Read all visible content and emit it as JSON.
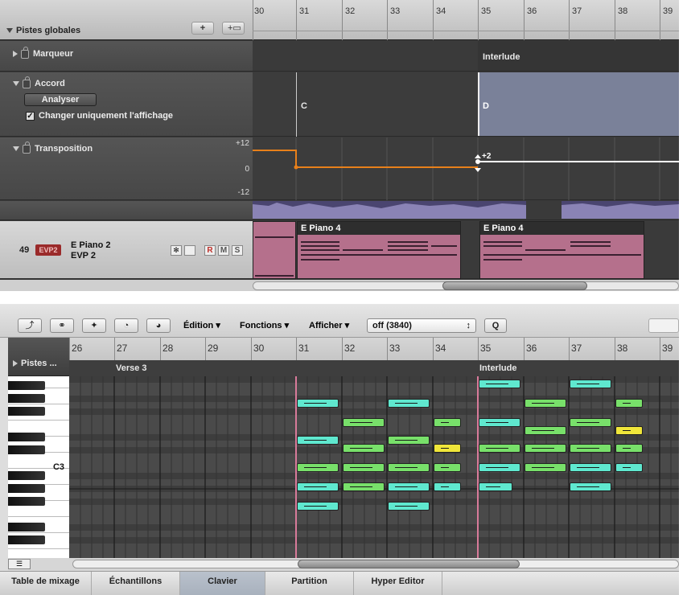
{
  "global_tracks": {
    "label": "Pistes globales",
    "add_icon": "plus-icon",
    "cfg_icon": "global-track-config-icon"
  },
  "ruler_top": [
    "30",
    "31",
    "32",
    "33",
    "34",
    "35",
    "36",
    "37",
    "38",
    "39"
  ],
  "marker_track": {
    "label": "Marqueur",
    "marker": "Interlude"
  },
  "chord_track": {
    "label": "Accord",
    "analyze_btn": "Analyser",
    "checkbox_label": "Changer uniquement l'affichage",
    "chord1": "C",
    "chord2": "D"
  },
  "transpose_track": {
    "label": "Transposition",
    "max": "+12",
    "zero": "0",
    "min": "-12",
    "value_label": "+2"
  },
  "track": {
    "number": "49",
    "icon_label": "EVP2",
    "name": "E Piano 2",
    "instrument": "EVP 2",
    "btn_r": "R",
    "btn_m": "M",
    "btn_s": "S",
    "region1": "E Piano 4",
    "region2": "E Piano 4"
  },
  "editor_toolbar": {
    "menu_edit": "Édition",
    "menu_functions": "Fonctions",
    "menu_view": "Afficher",
    "quantize": "off (3840)",
    "q_btn": "Q"
  },
  "ruler_bottom": [
    "26",
    "27",
    "28",
    "29",
    "30",
    "31",
    "32",
    "33",
    "34",
    "35",
    "36",
    "37",
    "38",
    "39"
  ],
  "editor": {
    "tracks_label": "Pistes ...",
    "marker_verse": "Verse 3",
    "marker_interlude": "Interlude",
    "c3_label": "C3"
  },
  "tabs": [
    "Table de mixage",
    "Échantillons",
    "Clavier",
    "Partition",
    "Hyper Editor"
  ],
  "colors": {
    "region": "#b5708c",
    "chord_region": "#7a8199",
    "transpose_line": "#e8801a",
    "playhead": "#d87a9a",
    "note_cyan": "#5fe8cf",
    "note_green": "#78e06a",
    "note_yellow": "#f0e63a"
  }
}
